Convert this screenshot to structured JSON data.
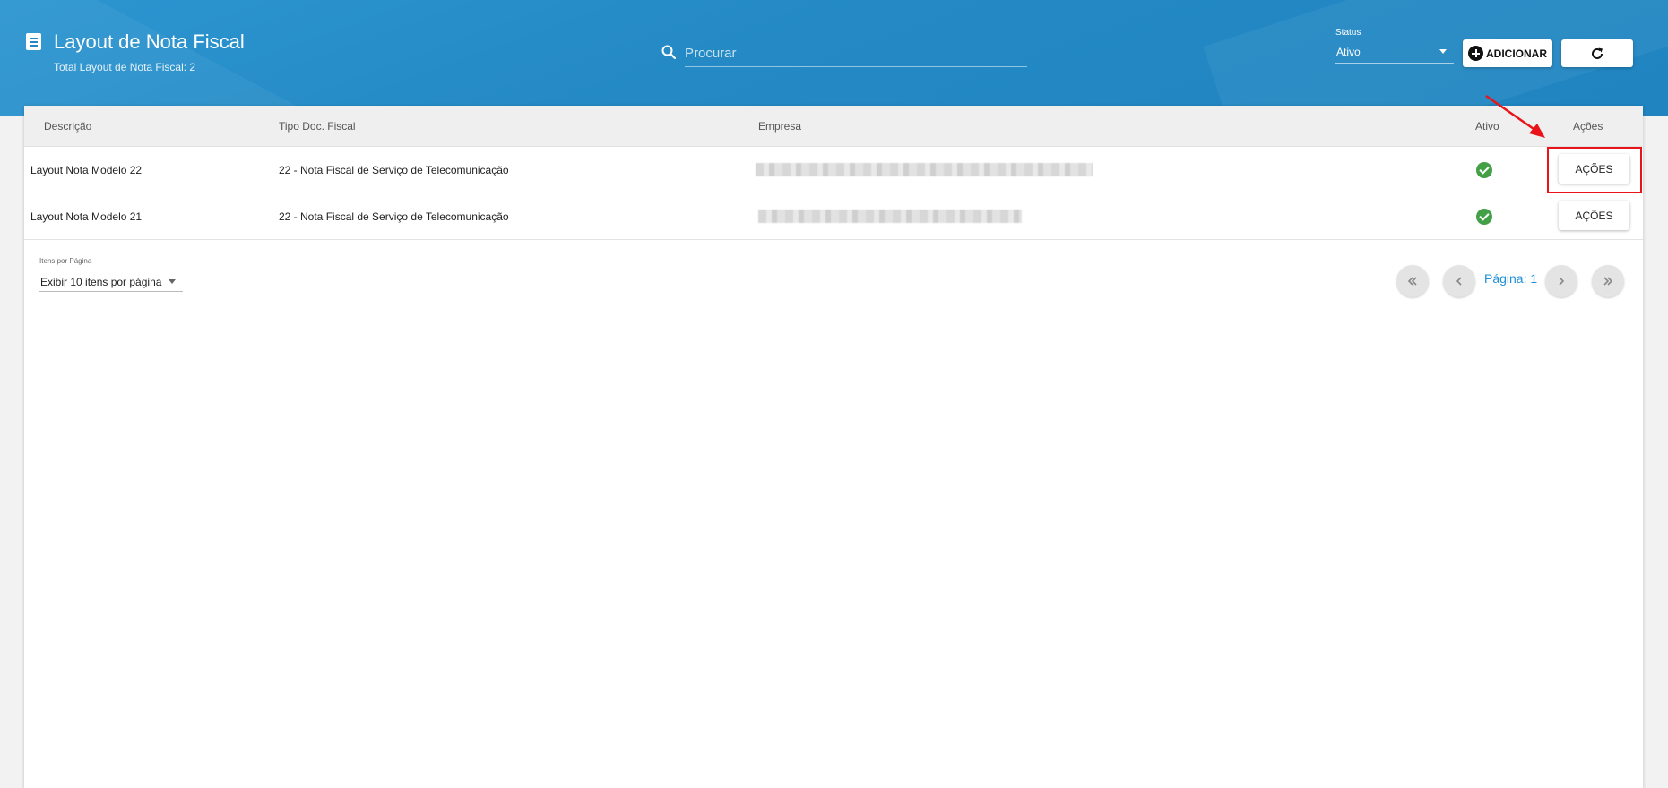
{
  "header": {
    "title": "Layout de Nota Fiscal",
    "subtitle": "Total Layout de Nota Fiscal: 2",
    "title_icon": "list-icon",
    "search_placeholder": "Procurar",
    "status_label": "Status",
    "status_value": "Ativo",
    "add_label": "ADICIONAR",
    "add_icon": "plus-circle-icon",
    "refresh_icon": "refresh-icon"
  },
  "table": {
    "columns": [
      "Descrição",
      "Tipo Doc. Fiscal",
      "Empresa",
      "Ativo",
      "Ações"
    ],
    "rows": [
      {
        "descricao": "Layout Nota Modelo 22",
        "tipo": "22 - Nota Fiscal de Serviço de Telecomunicação",
        "empresa": "",
        "ativo": true,
        "acoes": "AÇÕES"
      },
      {
        "descricao": "Layout Nota Modelo 21",
        "tipo": "22 - Nota Fiscal de Serviço de Telecomunicação",
        "empresa": "",
        "ativo": true,
        "acoes": "AÇÕES"
      }
    ]
  },
  "pagination": {
    "items_label": "Itens por Página",
    "items_value": "Exibir 10 itens por página",
    "page_label": "Página: 1"
  },
  "colors": {
    "header_blue": "#2489c4",
    "active_green": "#43a047",
    "page_link": "#1e8fd6",
    "annotation_red": "#e8141a"
  }
}
